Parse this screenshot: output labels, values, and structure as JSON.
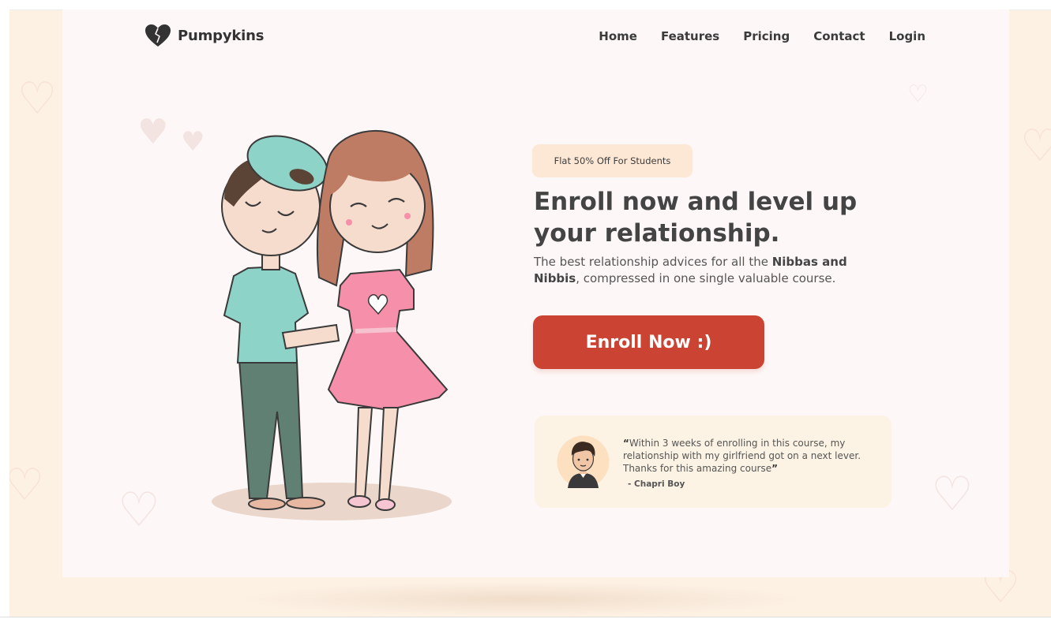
{
  "brand": {
    "name": "Pumpykins",
    "logo_icon": "heart-icon",
    "color": "#333333"
  },
  "nav": {
    "items": [
      "Home",
      "Features",
      "Pricing",
      "Contact",
      "Login"
    ]
  },
  "hero": {
    "promo": "Flat 50% Off For Students",
    "headline": "Enroll now and level up your relationship.",
    "sub_pre": "The best relationship advices for all the ",
    "sub_bold": "Nibbas and Nibbis",
    "sub_post": ", compressed in one single valuable course.",
    "cta": "Enroll Now :)"
  },
  "testimonial": {
    "open_quote": "“",
    "quote": "Within 3 weeks of enrolling in this course, my relationship with my girlfriend got on a next lever. Thanks for this amazing course",
    "close_quote": "”",
    "author": "- Chapri Boy"
  },
  "colors": {
    "accent": "#cb4433",
    "backdrop": "#fdf1e4",
    "card": "#fdf8f7",
    "promo_bg": "#fde8d6",
    "testimonial_bg": "#fdf3e4"
  }
}
